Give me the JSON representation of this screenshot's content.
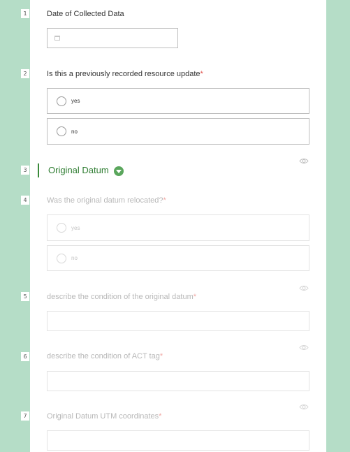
{
  "questions": [
    {
      "num": "1",
      "label": "Date of Collected Data",
      "required": ""
    },
    {
      "num": "2",
      "label": "Is this a previously recorded resource update",
      "required": "*",
      "options": [
        "yes",
        "no"
      ]
    },
    {
      "num": "3",
      "section_title": "Original Datum"
    },
    {
      "num": "4",
      "label": "Was the original datum relocated?",
      "required": "*",
      "options": [
        "yes",
        "no"
      ]
    },
    {
      "num": "5",
      "label": "describe the condition of the original datum",
      "required": "*",
      "value": ""
    },
    {
      "num": "6",
      "label": "describe the condition of ACT tag",
      "required": "*",
      "value": ""
    },
    {
      "num": "7",
      "label": "Original Datum UTM coordinates",
      "required": "*",
      "value": ""
    }
  ],
  "date_field": {
    "value": "",
    "icon": "calendar-icon"
  },
  "icons": {
    "section_toggle": "chevron-down-icon",
    "visibility": "eye-icon"
  },
  "colors": {
    "background": "#b5ddc7",
    "section_accent": "#2f7d32",
    "required": "#e0504a"
  }
}
